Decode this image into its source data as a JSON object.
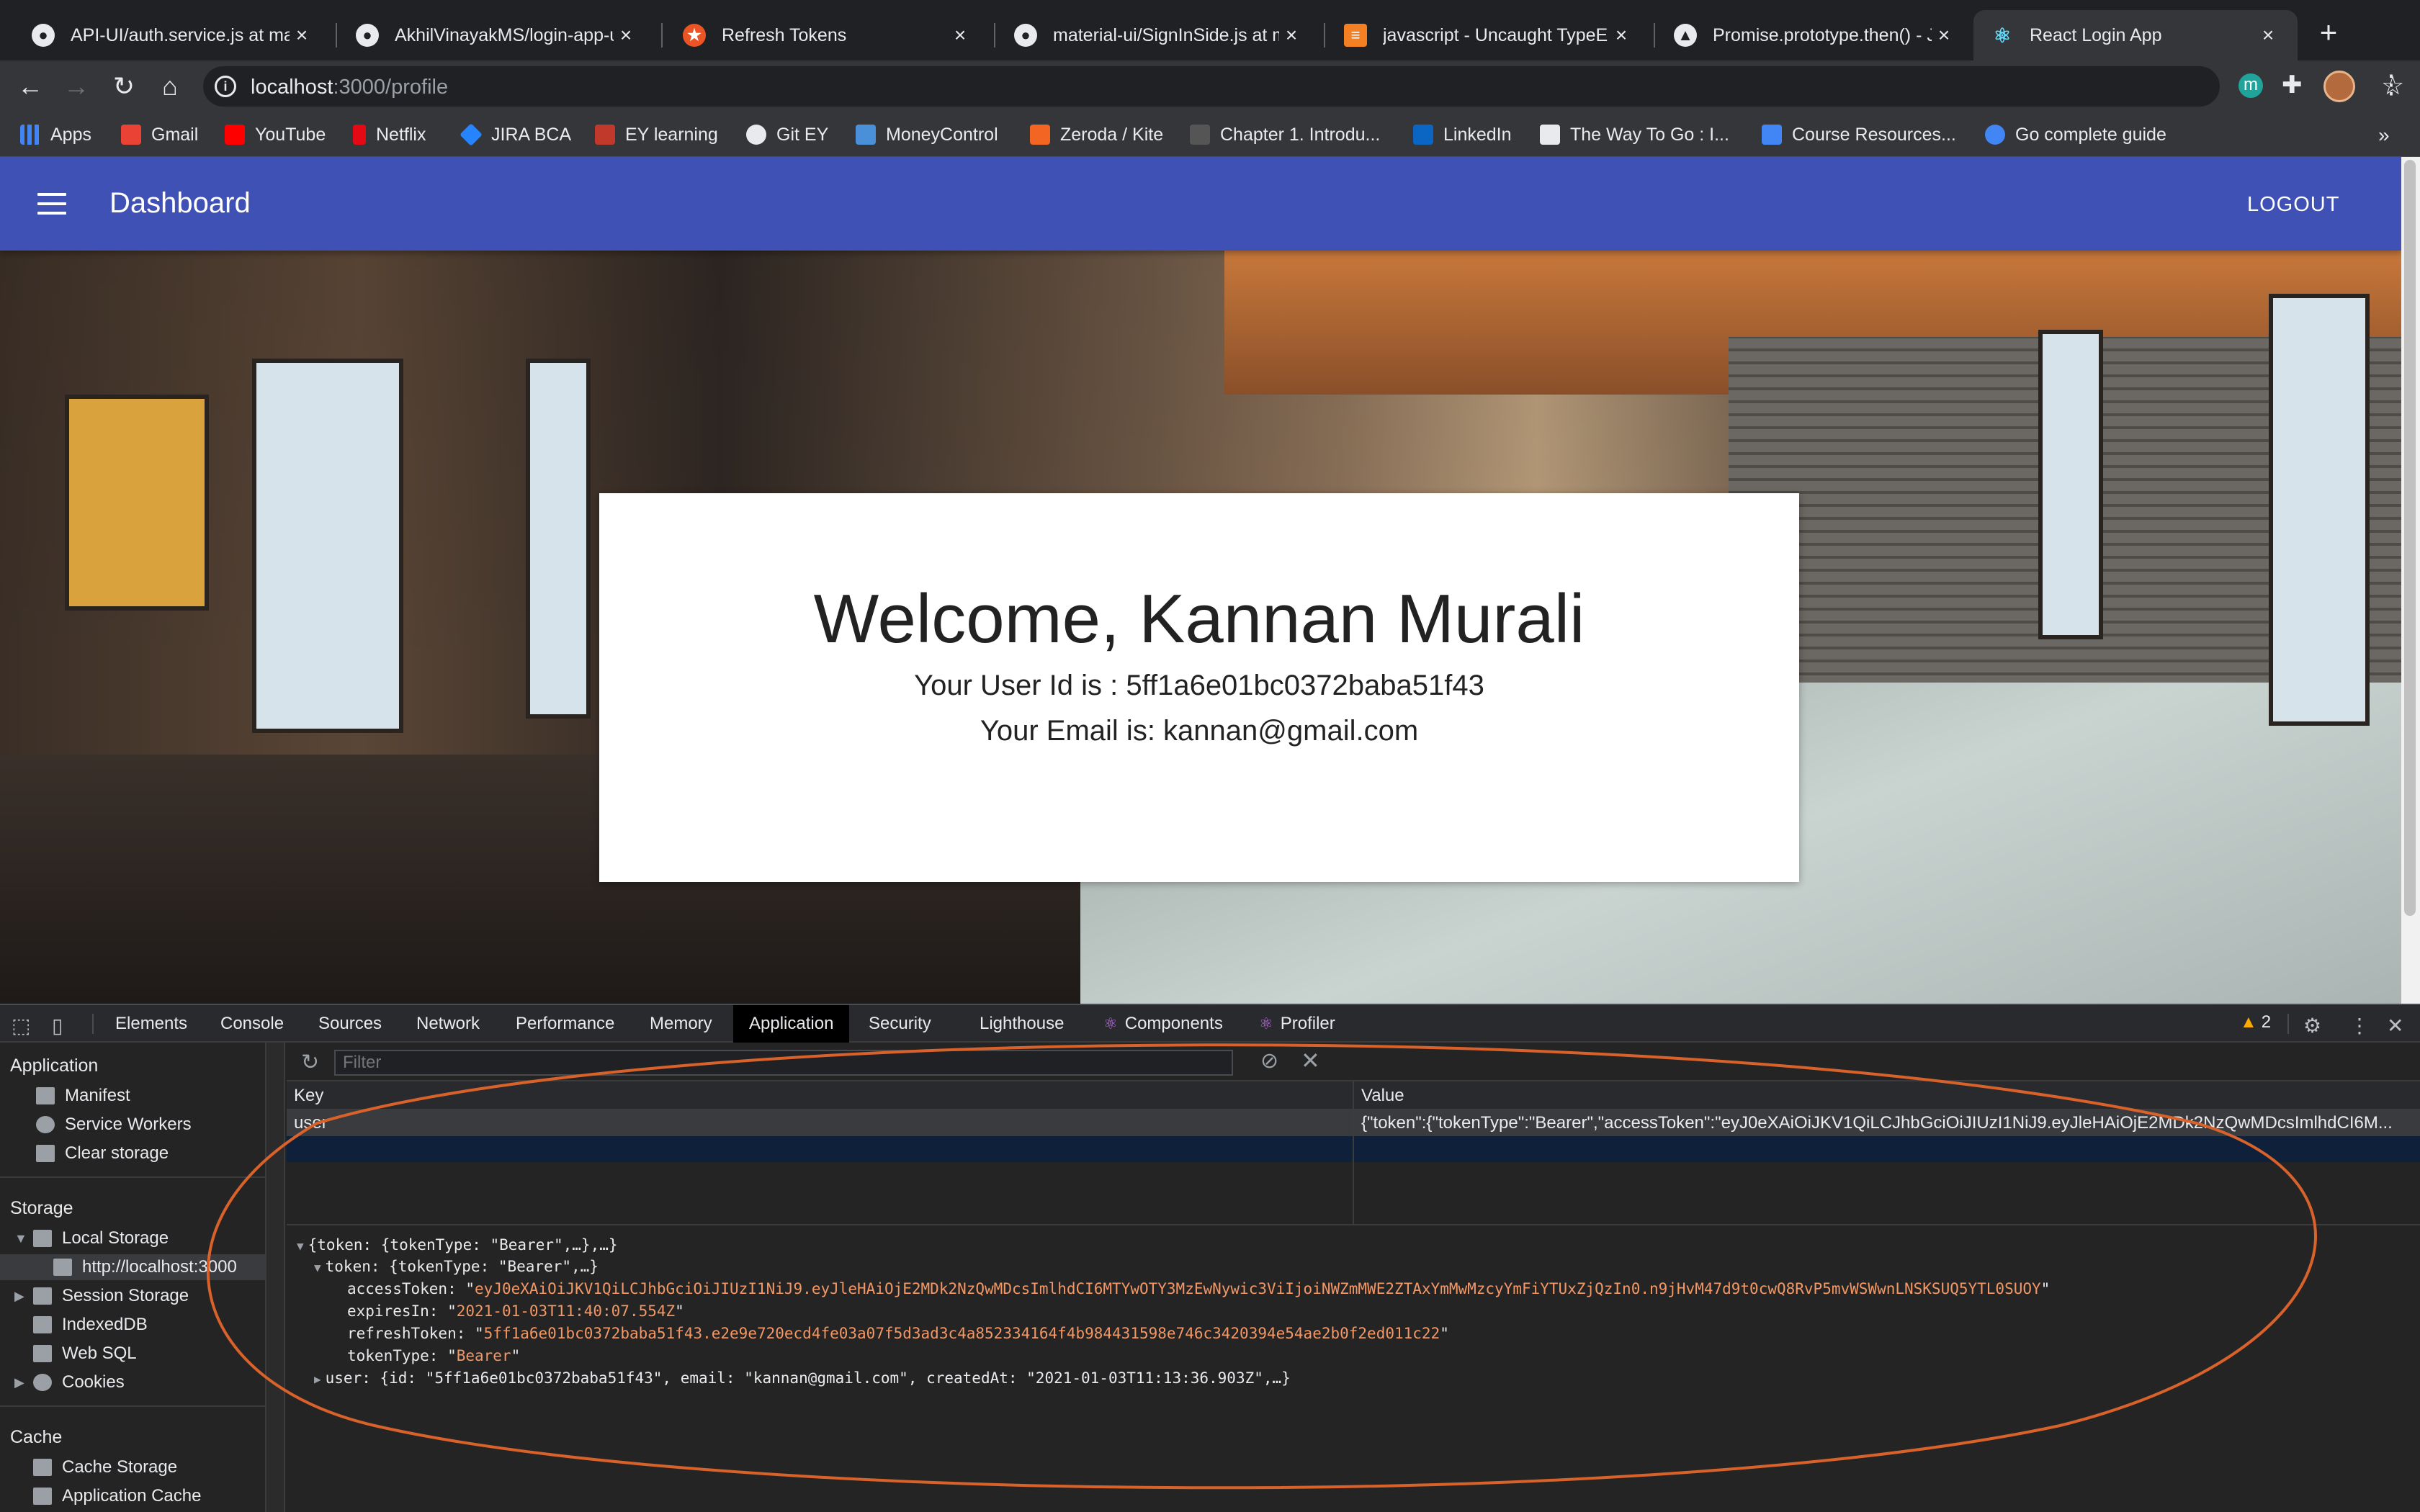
{
  "browser": {
    "tabs": [
      {
        "label": "API-UI/auth.service.js at mas",
        "icon": "github-icon",
        "active": false
      },
      {
        "label": "AkhilVinayakMS/login-app-ui",
        "icon": "github-icon",
        "active": false
      },
      {
        "label": "Refresh Tokens",
        "icon": "auth0-icon",
        "active": false
      },
      {
        "label": "material-ui/SignInSide.js at m",
        "icon": "github-icon",
        "active": false
      },
      {
        "label": "javascript - Uncaught TypeE",
        "icon": "stackoverflow-icon",
        "active": false
      },
      {
        "label": "Promise.prototype.then() - J",
        "icon": "mdn-icon",
        "active": false
      },
      {
        "label": "React Login App",
        "icon": "react-icon",
        "active": true
      }
    ],
    "url_host": "localhost",
    "url_path": ":3000/profile",
    "bookmarks": [
      {
        "label": "Apps",
        "color": "#4285f4"
      },
      {
        "label": "Gmail",
        "color": "#ea4335"
      },
      {
        "label": "YouTube",
        "color": "#ff0000"
      },
      {
        "label": "Netflix",
        "color": "#e50914"
      },
      {
        "label": "JIRA BCA",
        "color": "#2684ff"
      },
      {
        "label": "EY learning",
        "color": "#c0392b"
      },
      {
        "label": "Git EY",
        "color": "#e8eaed"
      },
      {
        "label": "MoneyControl",
        "color": "#4a90d9"
      },
      {
        "label": "Zeroda / Kite",
        "color": "#f26522"
      },
      {
        "label": "Chapter 1. Introdu...",
        "color": "#555555"
      },
      {
        "label": "LinkedIn",
        "color": "#0a66c2"
      },
      {
        "label": "The Way To Go : I...",
        "color": "#e8eaed"
      },
      {
        "label": "Course Resources...",
        "color": "#4285f4"
      },
      {
        "label": "Go complete guide",
        "color": "#4285f4"
      }
    ],
    "ext_letter": "m",
    "more_bookmarks": "»"
  },
  "app": {
    "title": "Dashboard",
    "logout_label": "LOGOUT",
    "welcome_title": "Welcome, Kannan Murali",
    "user_id_line": "Your User Id is : 5ff1a6e01bc0372baba51f43",
    "email_line": "Your Email is: kannan@gmail.com",
    "accent_color": "#3f51b5"
  },
  "devtools": {
    "tabs": [
      "Elements",
      "Console",
      "Sources",
      "Network",
      "Performance",
      "Memory",
      "Application",
      "Security",
      "Lighthouse",
      "Components",
      "Profiler"
    ],
    "active_tab": "Application",
    "warning_count": "2",
    "sidebar": {
      "application_heading": "Application",
      "application_items": [
        "Manifest",
        "Service Workers",
        "Clear storage"
      ],
      "storage_heading": "Storage",
      "storage_items": [
        "Local Storage",
        "http://localhost:3000",
        "Session Storage",
        "IndexedDB",
        "Web SQL",
        "Cookies"
      ],
      "cache_heading": "Cache",
      "cache_items": [
        "Cache Storage",
        "Application Cache"
      ]
    },
    "filter_placeholder": "Filter",
    "grid": {
      "key_header": "Key",
      "value_header": "Value",
      "row_key": "user",
      "row_value": "{\"token\":{\"tokenType\":\"Bearer\",\"accessToken\":\"eyJ0eXAiOiJKV1QiLCJhbGciOiJIUzI1NiJ9.eyJleHAiOjE2MDk2NzQwMDcsImlhdCI6M..."
    },
    "preview": {
      "root_line": "{token: {tokenType: \"Bearer\",…},…}",
      "token_line": "token: {tokenType: \"Bearer\",…}",
      "access_key": "accessToken: ",
      "access_val": "eyJ0eXAiOiJKV1QiLCJhbGciOiJIUzI1NiJ9.eyJleHAiOjE2MDk2NzQwMDcsImlhdCI6MTYwOTY3MzEwNywic3ViIjoiNWZmMWE2ZTAxYmMwMzcyYmFiYTUxZjQzIn0.n9jHvM47d9t0cwQ8RvP5mvWSWwnLNSKSUQ5YTL0SUOY",
      "expires_key": "expiresIn: ",
      "expires_val": "2021-01-03T11:40:07.554Z",
      "refresh_key": "refreshToken: ",
      "refresh_val": "5ff1a6e01bc0372baba51f43.e2e9e720ecd4fe03a07f5d3ad3c4a852334164f4b984431598e746c3420394e54ae2b0f2ed011c22",
      "type_key": "tokenType: ",
      "type_val": "Bearer",
      "user_line": "user: {id: \"5ff1a6e01bc0372baba51f43\", email: \"kannan@gmail.com\", createdAt: \"2021-01-03T11:13:36.903Z\",…}"
    },
    "annotation_color": "#d9622b"
  }
}
